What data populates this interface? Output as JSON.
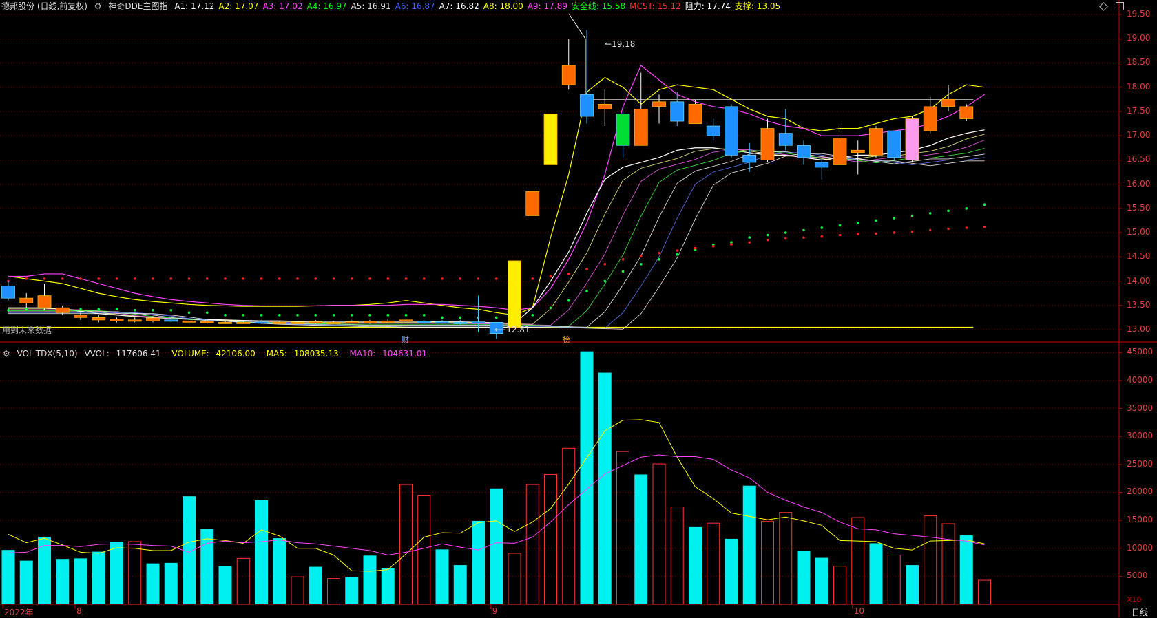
{
  "header": {
    "stock": "德邦股份 (日线,前复权)",
    "indicator": "神奇DDE主图指",
    "items": [
      {
        "label": "A1:",
        "value": "17.12",
        "color": "#ffffff"
      },
      {
        "label": "A2:",
        "value": "17.07",
        "color": "#ffff00"
      },
      {
        "label": "A3:",
        "value": "17.02",
        "color": "#ff44ff"
      },
      {
        "label": "A4:",
        "value": "16.97",
        "color": "#00ff00"
      },
      {
        "label": "A5:",
        "value": "16.91",
        "color": "#dddddd"
      },
      {
        "label": "A6:",
        "value": "16.87",
        "color": "#4060ff"
      },
      {
        "label": "A7:",
        "value": "16.82",
        "color": "#ffffff"
      },
      {
        "label": "A8:",
        "value": "18.00",
        "color": "#ffff00"
      },
      {
        "label": "A9:",
        "value": "17.89",
        "color": "#ff44ff"
      },
      {
        "label": "安全线:",
        "value": "15.58",
        "color": "#00ff00"
      },
      {
        "label": "MCST:",
        "value": "15.12",
        "color": "#ff3030"
      },
      {
        "label": "阻力:",
        "value": "17.74",
        "color": "#ffffff"
      },
      {
        "label": "支撑:",
        "value": "13.05",
        "color": "#ffff00"
      }
    ]
  },
  "notice": "用到未来数据",
  "markers": {
    "high": "19.18",
    "low": "12.81",
    "cai": "财",
    "bang": "榜"
  },
  "volume_header": {
    "name": "VOL-TDX(5,10)",
    "vvol_label": "VVOL:",
    "vvol": "117606.41",
    "volume_label": "VOLUME:",
    "volume": "42106.00",
    "ma5_label": "MA5:",
    "ma5": "108035.13",
    "ma10_label": "MA10:",
    "ma10": "104631.01"
  },
  "x10_label": "X10",
  "period_label": "日线",
  "colors": {
    "up": "#ff3030",
    "down": "#00f0f0",
    "ma5": "#ffff00",
    "ma10": "#ff44ff",
    "grid": "#7a0000",
    "axis": "#c00000"
  },
  "chart_data": [
    {
      "type": "candlestick",
      "ylim": [
        12.9,
        19.6
      ],
      "yticks": [
        "13.00",
        "13.50",
        "14.00",
        "14.50",
        "15.00",
        "15.50",
        "16.00",
        "16.50",
        "17.00",
        "17.50",
        "18.00",
        "18.50",
        "19.00",
        "19.50"
      ],
      "resistance": 17.74,
      "support": 13.05,
      "candles": [
        {
          "o": 13.9,
          "c": 13.65,
          "h": 14.0,
          "l": 13.6
        },
        {
          "o": 13.55,
          "c": 13.65,
          "h": 13.75,
          "l": 13.45
        },
        {
          "o": 13.45,
          "c": 13.7,
          "h": 13.95,
          "l": 13.4
        },
        {
          "o": 13.35,
          "c": 13.45,
          "h": 13.5,
          "l": 13.3
        },
        {
          "o": 13.25,
          "c": 13.3,
          "h": 13.35,
          "l": 13.2
        },
        {
          "o": 13.2,
          "c": 13.25,
          "h": 13.3,
          "l": 13.15
        },
        {
          "o": 13.18,
          "c": 13.22,
          "h": 13.25,
          "l": 13.15
        },
        {
          "o": 13.2,
          "c": 13.2,
          "h": 13.25,
          "l": 13.15
        },
        {
          "o": 13.18,
          "c": 13.24,
          "h": 13.28,
          "l": 13.15
        },
        {
          "o": 13.2,
          "c": 13.18,
          "h": 13.25,
          "l": 13.15
        },
        {
          "o": 13.16,
          "c": 13.18,
          "h": 13.2,
          "l": 13.14
        },
        {
          "o": 13.15,
          "c": 13.17,
          "h": 13.2,
          "l": 13.12
        },
        {
          "o": 13.14,
          "c": 13.15,
          "h": 13.18,
          "l": 13.12
        },
        {
          "o": 13.14,
          "c": 13.15,
          "h": 13.18,
          "l": 13.12
        },
        {
          "o": 13.16,
          "c": 13.15,
          "h": 13.2,
          "l": 13.12
        },
        {
          "o": 13.14,
          "c": 13.15,
          "h": 13.18,
          "l": 13.12
        },
        {
          "o": 13.14,
          "c": 13.15,
          "h": 13.18,
          "l": 13.12
        },
        {
          "o": 13.15,
          "c": 13.16,
          "h": 13.2,
          "l": 13.12
        },
        {
          "o": 13.14,
          "c": 13.15,
          "h": 13.18,
          "l": 13.12
        },
        {
          "o": 13.15,
          "c": 13.16,
          "h": 13.19,
          "l": 13.13
        },
        {
          "o": 13.15,
          "c": 13.17,
          "h": 13.2,
          "l": 13.12
        },
        {
          "o": 13.16,
          "c": 13.18,
          "h": 13.22,
          "l": 13.13
        },
        {
          "o": 13.18,
          "c": 13.2,
          "h": 13.35,
          "l": 13.15
        },
        {
          "o": 13.17,
          "c": 13.15,
          "h": 13.2,
          "l": 13.12
        },
        {
          "o": 13.16,
          "c": 13.15,
          "h": 13.2,
          "l": 13.12
        },
        {
          "o": 13.15,
          "c": 13.13,
          "h": 13.2,
          "l": 13.1
        },
        {
          "o": 13.16,
          "c": 13.15,
          "h": 13.7,
          "l": 12.95
        },
        {
          "o": 13.15,
          "c": 12.92,
          "h": 13.15,
          "l": 12.81
        },
        {
          "o": 13.05,
          "c": 14.42,
          "h": 14.42,
          "l": 13.05
        },
        {
          "o": 15.35,
          "c": 15.85,
          "h": 15.85,
          "l": 15.35
        },
        {
          "o": 16.4,
          "c": 17.45,
          "h": 17.45,
          "l": 16.4
        },
        {
          "o": 18.05,
          "c": 18.45,
          "h": 19.0,
          "l": 17.95
        },
        {
          "o": 17.85,
          "c": 17.4,
          "h": 19.18,
          "l": 17.25
        },
        {
          "o": 17.55,
          "c": 17.65,
          "h": 17.95,
          "l": 17.2
        },
        {
          "o": 17.45,
          "c": 16.8,
          "h": 17.5,
          "l": 16.55
        },
        {
          "o": 16.8,
          "c": 17.55,
          "h": 18.3,
          "l": 16.8
        },
        {
          "o": 17.6,
          "c": 17.7,
          "h": 17.85,
          "l": 17.25
        },
        {
          "o": 17.7,
          "c": 17.3,
          "h": 17.9,
          "l": 17.2
        },
        {
          "o": 17.25,
          "c": 17.65,
          "h": 17.75,
          "l": 17.25
        },
        {
          "o": 17.2,
          "c": 17.0,
          "h": 17.35,
          "l": 16.9
        },
        {
          "o": 17.6,
          "c": 16.6,
          "h": 17.65,
          "l": 16.55
        },
        {
          "o": 16.6,
          "c": 16.45,
          "h": 16.85,
          "l": 16.25
        },
        {
          "o": 16.5,
          "c": 17.15,
          "h": 17.35,
          "l": 16.45
        },
        {
          "o": 17.05,
          "c": 16.8,
          "h": 17.55,
          "l": 16.7
        },
        {
          "o": 16.8,
          "c": 16.55,
          "h": 16.9,
          "l": 16.4
        },
        {
          "o": 16.45,
          "c": 16.35,
          "h": 16.55,
          "l": 16.1
        },
        {
          "o": 16.4,
          "c": 16.95,
          "h": 17.25,
          "l": 16.4
        },
        {
          "o": 16.65,
          "c": 16.7,
          "h": 16.9,
          "l": 16.2
        },
        {
          "o": 16.6,
          "c": 17.15,
          "h": 17.2,
          "l": 16.55
        },
        {
          "o": 17.1,
          "c": 16.55,
          "h": 17.1,
          "l": 16.5
        },
        {
          "o": 16.5,
          "c": 17.35,
          "h": 17.4,
          "l": 16.45
        },
        {
          "o": 17.1,
          "c": 17.6,
          "h": 17.8,
          "l": 17.05
        },
        {
          "o": 17.6,
          "c": 17.75,
          "h": 18.05,
          "l": 17.5
        },
        {
          "o": 17.35,
          "c": 17.6,
          "h": 17.65,
          "l": 17.3
        }
      ],
      "series": [
        {
          "values": [
            14.1,
            14.05,
            14.0,
            13.95,
            13.85,
            13.75,
            13.68,
            13.62,
            13.58,
            13.55,
            13.52,
            13.5,
            13.49,
            13.48,
            13.48,
            13.48,
            13.48,
            13.49,
            13.5,
            13.5,
            13.52,
            13.55,
            13.6,
            13.55,
            13.5,
            13.45,
            13.42,
            13.35,
            13.3,
            13.45,
            14.9,
            16.2,
            17.9,
            18.2,
            18.0,
            17.65,
            17.95,
            18.05,
            18.0,
            17.95,
            17.75,
            17.55,
            17.4,
            17.35,
            17.15,
            17.1,
            17.15,
            17.15,
            17.25,
            17.35,
            17.4,
            17.55,
            17.85,
            18.05,
            18.0
          ]
        },
        {
          "values": [
            14.1,
            14.1,
            14.15,
            14.15,
            14.05,
            13.95,
            13.85,
            13.75,
            13.68,
            13.62,
            13.58,
            13.55,
            13.52,
            13.5,
            13.49,
            13.49,
            13.49,
            13.49,
            13.5,
            13.5,
            13.5,
            13.5,
            13.52,
            13.52,
            13.52,
            13.5,
            13.48,
            13.45,
            13.4,
            13.45,
            13.85,
            14.45,
            15.2,
            16.2,
            17.6,
            18.45,
            18.15,
            17.85,
            17.7,
            17.6,
            17.55,
            17.45,
            17.3,
            17.2,
            17.15,
            17.0,
            17.0,
            17.0,
            17.05,
            17.1,
            17.15,
            17.25,
            17.4,
            17.6,
            17.85
          ]
        },
        {
          "values": [
            13.45,
            13.45,
            13.45,
            13.42,
            13.38,
            13.33,
            13.3,
            13.27,
            13.25,
            13.23,
            13.22,
            13.21,
            13.2,
            13.19,
            13.18,
            13.18,
            13.17,
            13.17,
            13.17,
            13.17,
            13.17,
            13.17,
            13.17,
            13.17,
            13.16,
            13.16,
            13.15,
            13.14,
            13.13,
            13.45,
            14.0,
            14.6,
            15.4,
            16.1,
            16.35,
            16.45,
            16.55,
            16.7,
            16.75,
            16.75,
            16.7,
            16.65,
            16.6,
            16.6,
            16.55,
            16.5,
            16.55,
            16.6,
            16.6,
            16.65,
            16.7,
            16.8,
            16.95,
            17.05,
            17.12
          ]
        }
      ],
      "safety_line": [
        13.4,
        13.42,
        13.42,
        13.42,
        13.42,
        13.42,
        13.42,
        13.4,
        13.4,
        13.4,
        13.35,
        13.35,
        13.3,
        13.3,
        13.3,
        13.3,
        13.3,
        13.3,
        13.3,
        13.3,
        13.3,
        13.3,
        13.3,
        13.3,
        13.25,
        13.25,
        13.25,
        13.25,
        13.25,
        13.3,
        13.45,
        13.6,
        13.8,
        14.0,
        14.2,
        14.35,
        14.45,
        14.55,
        14.65,
        14.75,
        14.8,
        14.9,
        14.95,
        15.0,
        15.05,
        15.1,
        15.15,
        15.2,
        15.25,
        15.3,
        15.35,
        15.4,
        15.45,
        15.5,
        15.58
      ],
      "mcst": [
        14.0,
        14.05,
        14.05,
        14.05,
        14.05,
        14.05,
        14.05,
        14.05,
        14.05,
        14.05,
        14.05,
        14.05,
        14.05,
        14.05,
        14.05,
        14.05,
        14.05,
        14.05,
        14.05,
        14.05,
        14.05,
        14.05,
        14.05,
        14.05,
        14.05,
        14.05,
        14.05,
        14.05,
        14.05,
        14.05,
        14.1,
        14.15,
        14.25,
        14.35,
        14.45,
        14.52,
        14.58,
        14.63,
        14.68,
        14.72,
        14.76,
        14.8,
        14.85,
        14.88,
        14.9,
        14.92,
        14.95,
        14.97,
        14.98,
        15.0,
        15.02,
        15.05,
        15.08,
        15.1,
        15.12
      ]
    },
    {
      "type": "bar",
      "ylim": [
        0,
        47500
      ],
      "yticks": [
        "5000",
        "10000",
        "15000",
        "20000",
        "25000",
        "30000",
        "35000",
        "40000",
        "45000"
      ],
      "xticks": [
        "2022年",
        "8",
        "9",
        "10"
      ],
      "values": [
        9700,
        7800,
        12000,
        8100,
        8200,
        9400,
        11100,
        11200,
        7300,
        7400,
        19300,
        13500,
        6800,
        8200,
        18600,
        11800,
        4900,
        6700,
        4600,
        4900,
        8700,
        6400,
        21400,
        19500,
        9800,
        7000,
        14900,
        20700,
        9100,
        21400,
        23200,
        27900,
        45200,
        41400,
        27300,
        23200,
        25100,
        17400,
        13800,
        14500,
        11700,
        21200,
        14800,
        16400,
        9600,
        8300,
        6800,
        15500,
        10900,
        8800,
        7000,
        15800,
        14400,
        12300,
        4300
      ],
      "up": [
        false,
        false,
        false,
        false,
        false,
        false,
        false,
        true,
        false,
        false,
        false,
        false,
        false,
        true,
        false,
        false,
        true,
        false,
        true,
        false,
        false,
        false,
        true,
        true,
        false,
        false,
        false,
        false,
        true,
        true,
        true,
        true,
        false,
        false,
        true,
        false,
        true,
        true,
        false,
        true,
        false,
        false,
        true,
        true,
        false,
        false,
        true,
        true,
        false,
        true,
        false,
        true,
        true,
        false,
        true
      ],
      "ma5": [
        12500,
        11000,
        11800,
        10600,
        9300,
        9100,
        10100,
        10000,
        9600,
        9600,
        11100,
        11700,
        11400,
        10900,
        13300,
        12200,
        10000,
        10000,
        8800,
        6000,
        5900,
        6200,
        9000,
        12000,
        12800,
        12700,
        14600,
        14900,
        13000,
        14700,
        17100,
        21500,
        26200,
        31000,
        32900,
        33000,
        32500,
        26300,
        21000,
        18900,
        16300,
        15700,
        15100,
        15600,
        14900,
        14100,
        11400,
        11300,
        11200,
        10000,
        9700,
        11300,
        11400,
        11500,
        10800
      ],
      "ma10": [
        9200,
        9300,
        10500,
        10500,
        10300,
        10700,
        10800,
        10700,
        10500,
        10400,
        9300,
        10900,
        11300,
        11000,
        11200,
        11500,
        11000,
        10800,
        10400,
        10000,
        9600,
        8800,
        9300,
        10000,
        10800,
        10200,
        9700,
        11000,
        10900,
        12000,
        14700,
        17800,
        20600,
        23300,
        24800,
        26300,
        26700,
        26400,
        26400,
        25900,
        24000,
        22600,
        20000,
        18600,
        17400,
        16400,
        14700,
        13500,
        13300,
        12600,
        12300,
        12000,
        11600,
        11300,
        10600
      ]
    }
  ]
}
